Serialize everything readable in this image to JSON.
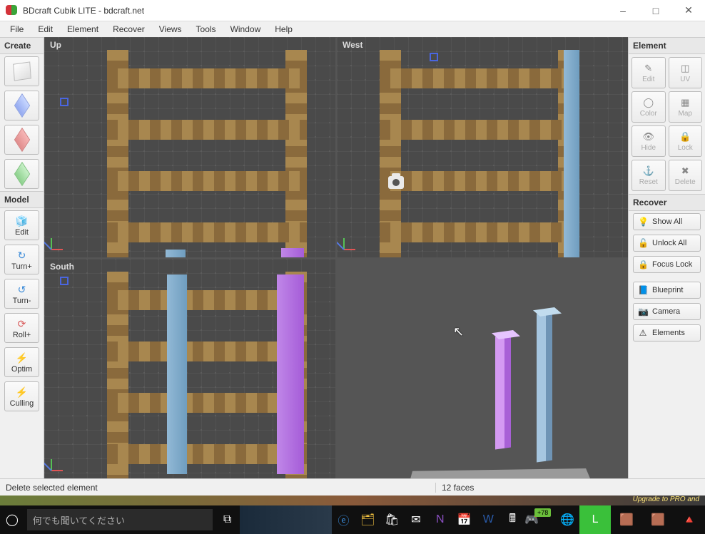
{
  "window": {
    "title": "BDcraft Cubik LITE - bdcraft.net"
  },
  "menu": [
    "File",
    "Edit",
    "Element",
    "Recover",
    "Views",
    "Tools",
    "Window",
    "Help"
  ],
  "left": {
    "create_header": "Create",
    "model_header": "Model",
    "model_buttons": [
      {
        "id": "edit",
        "label": "Edit",
        "icon": "✎"
      },
      {
        "id": "turnp",
        "label": "Turn+",
        "icon": "↻"
      },
      {
        "id": "turnm",
        "label": "Turn-",
        "icon": "↺"
      },
      {
        "id": "rollp",
        "label": "Roll+",
        "icon": "⟳"
      },
      {
        "id": "optim",
        "label": "Optim",
        "icon": "⚡"
      },
      {
        "id": "culling",
        "label": "Culling",
        "icon": "⚡"
      }
    ]
  },
  "viewports": {
    "up": {
      "label": "Up"
    },
    "west": {
      "label": "West"
    },
    "south": {
      "label": "South"
    }
  },
  "right": {
    "element_header": "Element",
    "element_buttons": [
      {
        "id": "edit",
        "label": "Edit",
        "icon": "✎"
      },
      {
        "id": "uv",
        "label": "UV",
        "icon": "◫"
      },
      {
        "id": "color",
        "label": "Color",
        "icon": "◯"
      },
      {
        "id": "map",
        "label": "Map",
        "icon": "▦"
      },
      {
        "id": "hide",
        "label": "Hide",
        "icon": "👁"
      },
      {
        "id": "lock",
        "label": "Lock",
        "icon": "🔒"
      },
      {
        "id": "reset",
        "label": "Reset",
        "icon": "⚓"
      },
      {
        "id": "delete",
        "label": "Delete",
        "icon": "✖"
      }
    ],
    "recover_header": "Recover",
    "recover_buttons": [
      {
        "id": "showall",
        "label": "Show All",
        "icon": "💡"
      },
      {
        "id": "unlockall",
        "label": "Unlock All",
        "icon": "🔓"
      },
      {
        "id": "focuslock",
        "label": "Focus Lock",
        "icon": "🔒"
      },
      {
        "id": "blueprint",
        "label": "Blueprint",
        "icon": "📘"
      },
      {
        "id": "camera",
        "label": "Camera",
        "icon": "📷"
      },
      {
        "id": "elements",
        "label": "Elements",
        "icon": "⚠"
      }
    ]
  },
  "status": {
    "left": "Delete selected element",
    "mid": "12 faces"
  },
  "footer": {
    "upgrade": "Upgrade to PRO and",
    "search_placeholder": "何でも聞いてください",
    "badge": "+78"
  }
}
